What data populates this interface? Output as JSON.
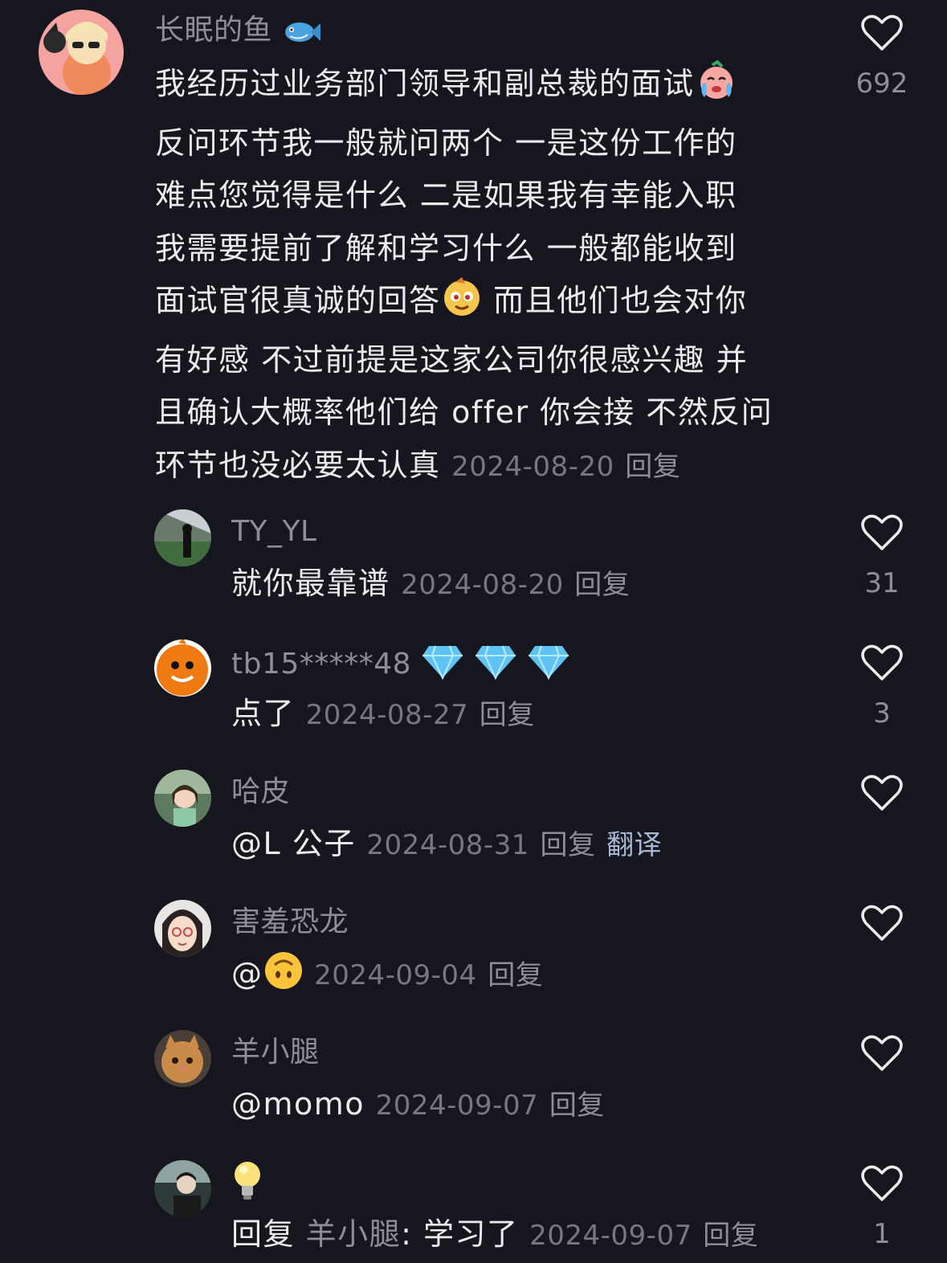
{
  "main_comment": {
    "username": "长眠的鱼",
    "username_emoji": "fish-emoji",
    "lines": [
      "我经历过业务部门领导和副总裁的面试",
      "反问环节我一般就问两个 一是这份工作的",
      "难点您觉得是什么 二是如果我有幸能入职",
      "我需要提前了解和学习什么 一般都能收到",
      "面试官很真诚的回答",
      " 而且他们也会对你",
      "有好感 不过前提是这家公司你很感兴趣 并",
      "且确认大概率他们给 offer 你会接 不然反问",
      "环节也没必要太认真"
    ],
    "date": "2024-08-20",
    "reply_label": "回复",
    "likes": "692"
  },
  "replies": [
    {
      "username": "TY_YL",
      "text": "就你最靠谱",
      "date": "2024-08-20",
      "reply_label": "回复",
      "likes": "31"
    },
    {
      "username": "tb15*****48",
      "text": "点了",
      "date": "2024-08-27",
      "reply_label": "回复",
      "likes": "3"
    },
    {
      "username": "哈皮",
      "text": " @L 公子 ",
      "date": "2024-08-31",
      "reply_label": "回复",
      "translate_label": "翻译",
      "likes": ""
    },
    {
      "username": "害羞恐龙",
      "text": "@",
      "date": "2024-09-04",
      "reply_label": "回复",
      "likes": ""
    },
    {
      "username": "羊小腿",
      "text": "@momo",
      "date": "2024-09-07",
      "reply_label": "回复",
      "likes": ""
    },
    {
      "username": "💡",
      "reply_prefix": "回复",
      "reply_to": "羊小腿",
      "text": ": 学习了",
      "date": "2024-09-07",
      "reply_label": "回复",
      "likes": "1"
    }
  ],
  "colors": {
    "background": "#16161e",
    "primary_text": "#ececee",
    "secondary_text": "#8e8e96",
    "translate_link": "#a8b9d6"
  }
}
